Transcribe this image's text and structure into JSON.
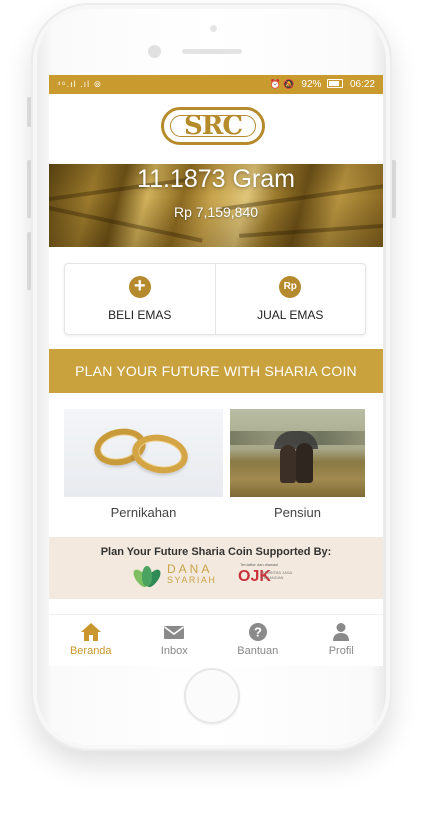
{
  "status_bar": {
    "left_text": "⁴⁶.ıl .ıl ⊚",
    "right_icons": "⏰ 🔕",
    "battery": "92%",
    "time": "06:22"
  },
  "logo_text": "SRC",
  "balance": {
    "weight": "11.1873 Gram",
    "value": "Rp 7,159,840"
  },
  "actions": [
    {
      "label": "BELI EMAS",
      "icon": "+"
    },
    {
      "label": "JUAL EMAS",
      "icon": "Rp"
    }
  ],
  "plan_banner": "PLAN YOUR FUTURE WITH SHARIA COIN",
  "plans": [
    {
      "label": "Pernikahan",
      "image": "wedding-rings"
    },
    {
      "label": "Pensiun",
      "image": "retired-couple"
    }
  ],
  "support": {
    "title": "Plan Your Future Sharia Coin Supported By:",
    "partner1_name": "DANA",
    "partner1_sub": "SYARIAH",
    "partner2_small": "Terdaftar dan diawasi",
    "partner2_logo": "OJK",
    "partner2_desc": "OTORITAS JASA KEUANGAN"
  },
  "nav": [
    {
      "label": "Beranda",
      "icon": "home-icon",
      "active": true
    },
    {
      "label": "Inbox",
      "icon": "mail-icon",
      "active": false
    },
    {
      "label": "Bantuan",
      "icon": "help-icon",
      "active": false
    },
    {
      "label": "Profil",
      "icon": "profile-icon",
      "active": false
    }
  ],
  "colors": {
    "gold": "#c99a2e",
    "gold_dark": "#b5892d",
    "support_bg": "#f3e9de"
  }
}
